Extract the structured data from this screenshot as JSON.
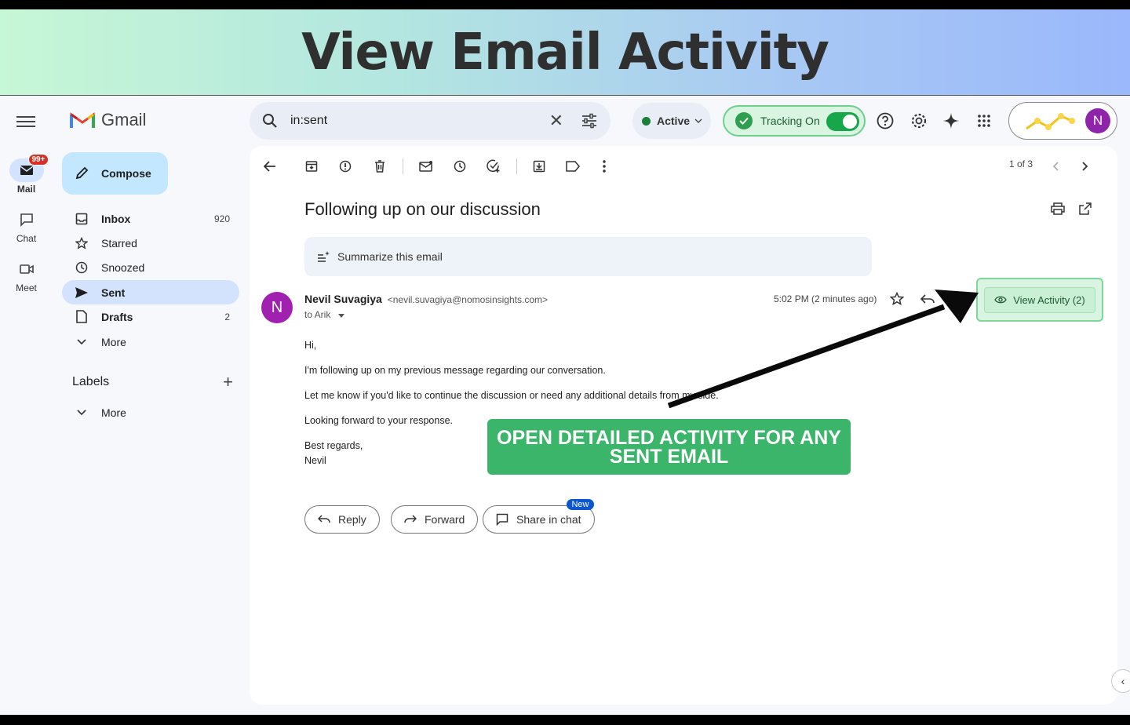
{
  "banner": {
    "title": "View Email Activity"
  },
  "rail": {
    "items": [
      {
        "label": "Mail",
        "badge": "99+"
      },
      {
        "label": "Chat"
      },
      {
        "label": "Meet"
      }
    ]
  },
  "sidebar": {
    "logo_text": "Gmail",
    "compose_label": "Compose",
    "nav": [
      {
        "label": "Inbox",
        "count": "920"
      },
      {
        "label": "Starred"
      },
      {
        "label": "Snoozed"
      },
      {
        "label": "Sent"
      },
      {
        "label": "Drafts",
        "count": "2"
      },
      {
        "label": "More"
      }
    ],
    "labels_heading": "Labels",
    "labels_more": "More"
  },
  "topbar": {
    "search_value": "in:sent",
    "status": "Active",
    "tracking": "Tracking On",
    "avatar_initial": "N"
  },
  "email": {
    "pager": "1 of 3",
    "subject": "Following up on our discussion",
    "summarize": "Summarize this email",
    "sender_initial": "N",
    "sender_name": "Nevil Suvagiya",
    "sender_email": "<nevil.suvagiya@nomosinsights.com>",
    "to": "to Arik",
    "time": "5:02 PM (2 minutes ago)",
    "view_activity": "View Activity (2)",
    "body": [
      "Hi,",
      "I'm following up on my previous message regarding our conversation.",
      "Let me know if you'd like to continue the discussion or need any additional details from my side.",
      "Looking forward to your response.",
      "Best regards,",
      "Nevil"
    ],
    "actions": {
      "reply": "Reply",
      "forward": "Forward",
      "share": "Share in chat",
      "new_tag": "New"
    }
  },
  "callout": {
    "line1": "OPEN DETAILED ACTIVITY FOR ANY",
    "line2": "SENT EMAIL"
  }
}
